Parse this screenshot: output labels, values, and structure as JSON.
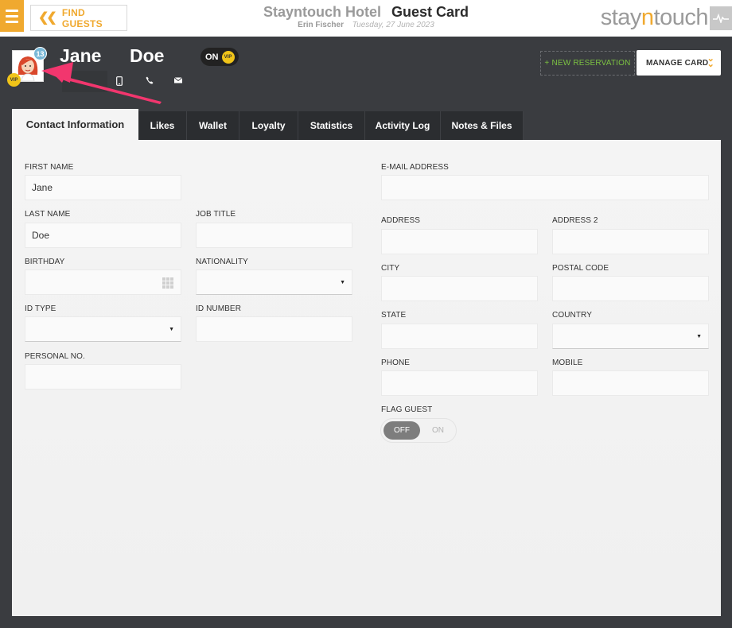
{
  "topbar": {
    "find_guests_label": "FIND GUESTS",
    "hotel_name": "Stayntouch Hotel",
    "page_title": "Guest Card",
    "user_name": "Erin Fischer",
    "date": "Tuesday, 27 June 2023",
    "logo_part1": "stay",
    "logo_part2": "n",
    "logo_part3": "touch"
  },
  "guest": {
    "first_name": "Jane",
    "last_name": "Doe",
    "count_badge": "13",
    "vip_badge": "VIP",
    "vip_toggle_label": "ON",
    "vip_toggle_badge": "VIP"
  },
  "actions": {
    "new_reservation": "+ NEW RESERVATION",
    "manage_card": "MANAGE CARD"
  },
  "tabs": [
    {
      "label": "Contact Information"
    },
    {
      "label": "Likes"
    },
    {
      "label": "Wallet"
    },
    {
      "label": "Loyalty"
    },
    {
      "label": "Statistics"
    },
    {
      "label": "Activity Log"
    },
    {
      "label": "Notes & Files"
    }
  ],
  "form": {
    "first_name_label": "FIRST NAME",
    "first_name_value": "Jane",
    "last_name_label": "LAST NAME",
    "last_name_value": "Doe",
    "job_title_label": "JOB TITLE",
    "birthday_label": "BIRTHDAY",
    "nationality_label": "NATIONALITY",
    "id_type_label": "ID TYPE",
    "id_number_label": "ID NUMBER",
    "personal_no_label": "PERSONAL NO.",
    "email_label": "E-MAIL ADDRESS",
    "address_label": "ADDRESS",
    "address2_label": "ADDRESS 2",
    "city_label": "CITY",
    "postal_code_label": "POSTAL CODE",
    "state_label": "STATE",
    "country_label": "COUNTRY",
    "phone_label": "PHONE",
    "mobile_label": "MOBILE",
    "flag_guest_label": "FLAG GUEST",
    "flag_off": "OFF",
    "flag_on": "ON"
  },
  "colors": {
    "accent": "#f0a92f",
    "header_bg": "#3a3c40",
    "new_reservation": "#7cc242",
    "annotation_arrow": "#f2366e"
  }
}
